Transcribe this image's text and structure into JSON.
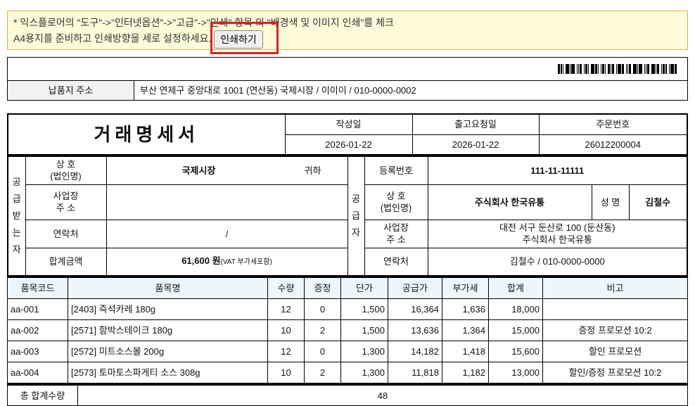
{
  "notice": {
    "line1": "* 익스플로어의 \"도구\"->\"인터넷옵션\"->\"고급\"->\"인쇄\" 항목 의 \"배경색 및 이미지 인쇄\"를 체크",
    "line2": "A4용지를 준비하고 인쇄방향을 세로 설정하세요.",
    "print_button": "인쇄하기"
  },
  "delivery": {
    "label": "납품지 주소",
    "value": "부산 연제구 중앙대로 1001 (연산동) 국제시장 / 이이이 / 010-0000-0002"
  },
  "doc": {
    "title": "거래명세서",
    "headers": [
      "작성일",
      "출고요청일",
      "주문번호"
    ],
    "values": [
      "2026-01-22",
      "2026-01-22",
      "26012200004"
    ]
  },
  "receiver": {
    "side_label": "공급받는자",
    "name_label": "상 호\n(법인명)",
    "name": "국제시장",
    "honorific": "귀하",
    "addr_label": "사업장\n주 소",
    "addr": "",
    "contact_label": "연락처",
    "contact": "/",
    "total_label": "합계금액",
    "total": "61,600 원",
    "total_note": "(VAT 부가세포함)"
  },
  "supplier": {
    "side_label": "공급자",
    "reg_label": "등록번호",
    "reg": "111-11-11111",
    "name_label": "상 호\n(법인명)",
    "name": "주식회사 한국유통",
    "ceo_label": "성 명",
    "ceo": "김철수",
    "addr_label": "사업장\n주 소",
    "addr1": "대전 서구 둔산로 100 (둔산동)",
    "addr2": "주식회사 한국유통",
    "contact_label": "연락처",
    "contact": "김철수 / 010-0000-0000"
  },
  "items": {
    "headers": [
      "품목코드",
      "품목명",
      "수량",
      "증정",
      "단가",
      "공급가",
      "부가세",
      "합계",
      "비고"
    ],
    "rows": [
      [
        "aa-001",
        "[2403] 즉석카레 180g",
        "12",
        "0",
        "1,500",
        "16,364",
        "1,636",
        "18,000",
        ""
      ],
      [
        "aa-002",
        "[2571] 함박스테이크 180g",
        "10",
        "2",
        "1,500",
        "13,636",
        "1,364",
        "15,000",
        "증정 프로모션 10:2"
      ],
      [
        "aa-003",
        "[2572] 미트소스볼 200g",
        "12",
        "0",
        "1,300",
        "14,182",
        "1,418",
        "15,600",
        "할인 프로모션"
      ],
      [
        "aa-004",
        "[2573] 토마토스파게티 소스 308g",
        "10",
        "2",
        "1,300",
        "11,818",
        "1,182",
        "13,000",
        "할인/증정 프로모션 10:2"
      ]
    ]
  },
  "summary": {
    "qty_label": "총 합계수량",
    "qty": "48"
  }
}
